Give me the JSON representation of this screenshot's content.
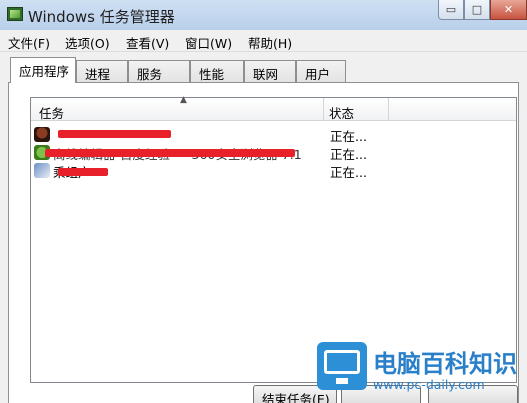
{
  "window": {
    "title": "Windows 任务管理器"
  },
  "titlebar_buttons": {
    "minimize": "▭",
    "maximize": "□",
    "close": "✕"
  },
  "menu": [
    "文件(F)",
    "选项(O)",
    "查看(V)",
    "窗口(W)",
    "帮助(H)"
  ],
  "tabs": [
    "应用程序",
    "进程",
    "服务",
    "性能",
    "联网",
    "用户"
  ],
  "active_tab": "应用程序",
  "columns": {
    "task": "任务",
    "status": "状态"
  },
  "rows": [
    {
      "name": "",
      "status": "正在..."
    },
    {
      "name": "离线编辑器-百度经验  ---  360安全浏览器 7.1",
      "status": "正在..."
    },
    {
      "name": "乘组户",
      "status": "正在..."
    }
  ],
  "buttons": {
    "end_task": "结束任务(E)"
  },
  "watermark": {
    "title": "电脑百科知识",
    "url": "www.pc-daily.com"
  },
  "colors": {
    "redaction": "#e8202a",
    "watermark_blue": "#2a7fc9"
  }
}
